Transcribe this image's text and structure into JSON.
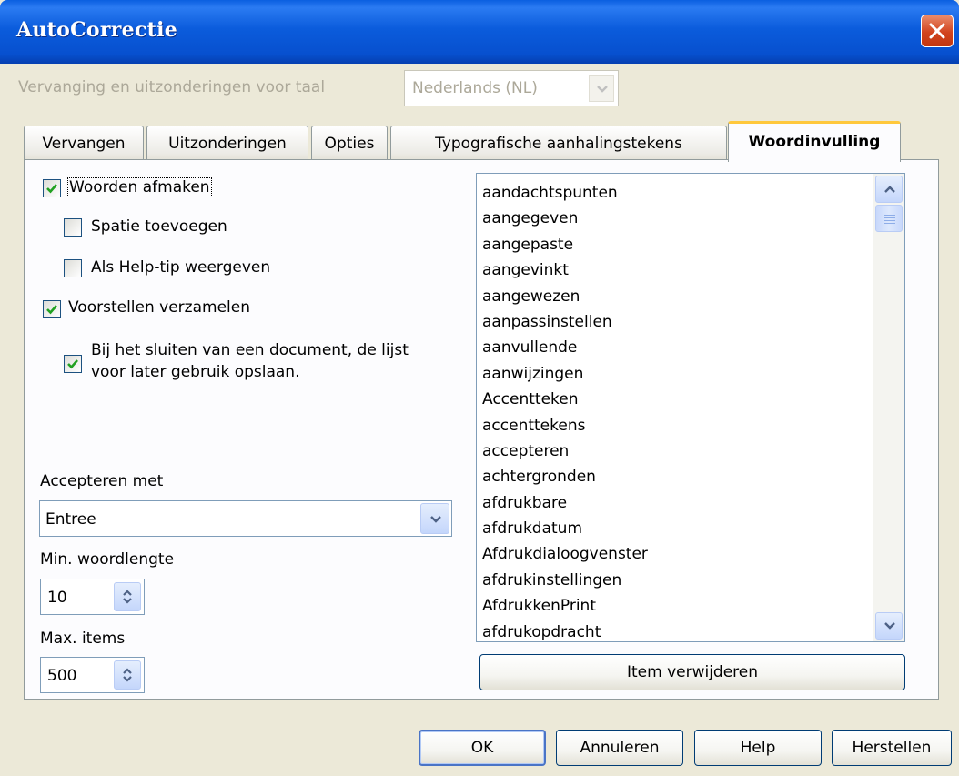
{
  "window": {
    "title": "AutoCorrectie"
  },
  "language": {
    "label": "Vervanging en uitzonderingen voor taal",
    "value": "Nederlands (NL)"
  },
  "tabs": [
    {
      "label": "Vervangen"
    },
    {
      "label": "Uitzonderingen"
    },
    {
      "label": "Opties"
    },
    {
      "label": "Typografische aanhalingstekens"
    },
    {
      "label": "Woordinvulling"
    }
  ],
  "options": {
    "complete_words": {
      "label": "Woorden afmaken",
      "checked": true
    },
    "append_space": {
      "label": "Spatie toevoegen",
      "checked": false
    },
    "show_as_tip": {
      "label": "Als Help-tip weergeven",
      "checked": false
    },
    "collect_words": {
      "label": "Voorstellen verzamelen",
      "checked": true
    },
    "keep_list_line1": "Bij het sluiten van een document, de lijst",
    "keep_list_line2": "voor later gebruik opslaan.",
    "keep_list_checked": true
  },
  "accept_with": {
    "label": "Accepteren met",
    "value": "Entree"
  },
  "min_word_length": {
    "label": "Min. woordlengte",
    "value": "10"
  },
  "max_entries": {
    "label": "Max. items",
    "value": "500"
  },
  "word_list": [
    "aandachtspunten",
    "aangegeven",
    "aangepaste",
    "aangevinkt",
    "aangewezen",
    "aanpassinstellen",
    "aanvullende",
    "aanwijzingen",
    "Accentteken",
    "accenttekens",
    "accepteren",
    "achtergronden",
    "afdrukbare",
    "afdrukdatum",
    "Afdrukdialoogvenster",
    "afdrukinstellingen",
    "AfdrukkenPrint",
    "afdrukopdracht"
  ],
  "delete_entry_label": "Item verwijderen",
  "footer": {
    "ok": "OK",
    "cancel": "Annuleren",
    "help": "Help",
    "reset": "Herstellen"
  }
}
